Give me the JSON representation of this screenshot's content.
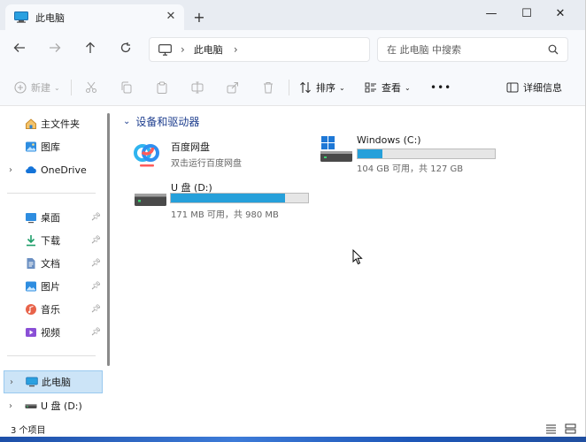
{
  "window": {
    "tab_title": "此电脑",
    "new_tab_symbol": "+",
    "close_tab_symbol": "✕",
    "minimize_symbol": "—",
    "maximize_symbol": "☐",
    "close_symbol": "✕"
  },
  "address": {
    "crumbs": [
      "此电脑"
    ],
    "search_placeholder": "在 此电脑 中搜索"
  },
  "toolbar": {
    "new_label": "新建",
    "sort_label": "排序",
    "view_label": "查看",
    "more_label": "•••",
    "details_label": "详细信息"
  },
  "sidebar": {
    "quick": [
      {
        "label": "主文件夹",
        "icon": "home-icon"
      },
      {
        "label": "图库",
        "icon": "gallery-icon"
      },
      {
        "label": "OneDrive",
        "icon": "onedrive-icon"
      }
    ],
    "pinned": [
      {
        "label": "桌面",
        "icon": "desktop-icon"
      },
      {
        "label": "下载",
        "icon": "download-icon"
      },
      {
        "label": "文档",
        "icon": "document-icon"
      },
      {
        "label": "图片",
        "icon": "pictures-icon"
      },
      {
        "label": "音乐",
        "icon": "music-icon"
      },
      {
        "label": "视频",
        "icon": "video-icon"
      }
    ],
    "devices": [
      {
        "label": "此电脑",
        "icon": "this-pc-icon",
        "selected": true
      },
      {
        "label": "U 盘 (D:)",
        "icon": "usb-drive-icon",
        "selected": false
      }
    ]
  },
  "content": {
    "group_title": "设备和驱动器",
    "items": [
      {
        "name": "百度网盘",
        "subtitle": "双击运行百度网盘",
        "icon": "baidu-netdisk-icon"
      },
      {
        "name": "Windows (C:)",
        "subtitle": "104 GB 可用，共 127 GB",
        "icon": "windows-drive-icon",
        "used_fraction": 0.18
      },
      {
        "name": "U 盘 (D:)",
        "subtitle": "171 MB 可用，共 980 MB",
        "icon": "usb-drive-icon",
        "used_fraction": 0.83
      }
    ]
  },
  "status": {
    "item_count": "3 个项目"
  },
  "colors": {
    "accent": "#26a0da",
    "selection": "#cce4f7",
    "group_header": "#1f3f8f"
  }
}
